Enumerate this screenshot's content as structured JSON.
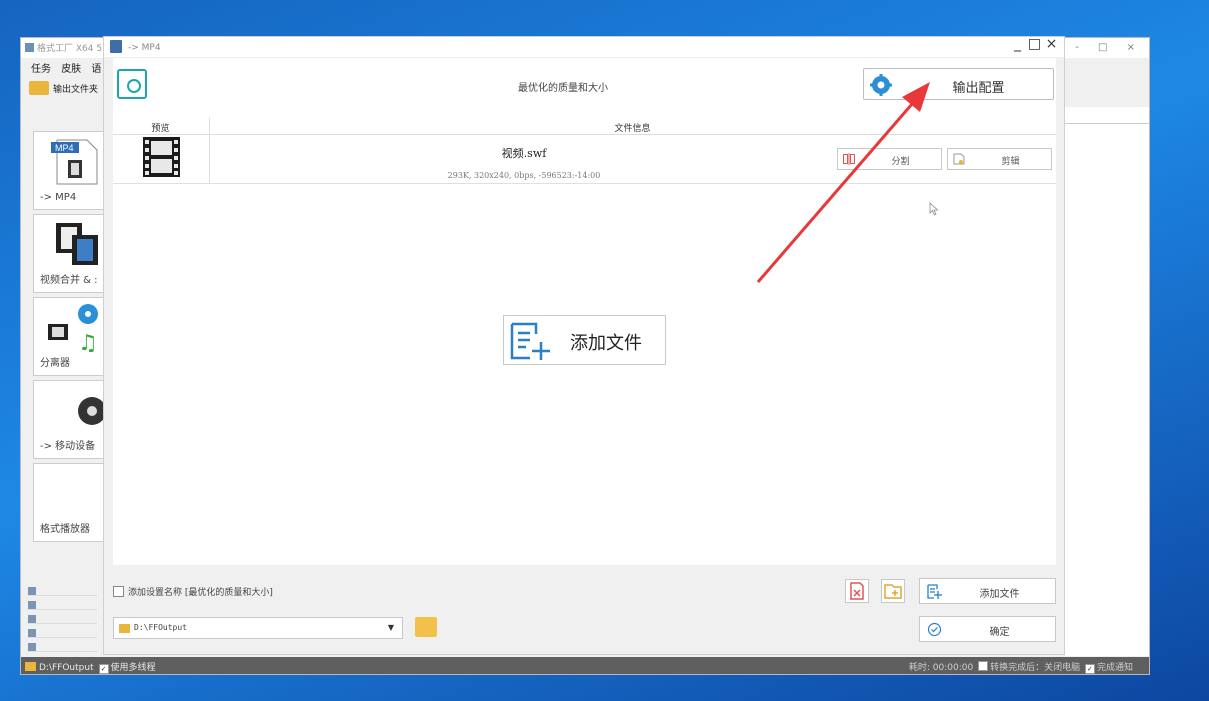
{
  "background_app": {
    "title": "格式工厂 X64 5",
    "menu": [
      "任务",
      "皮肤",
      "语"
    ],
    "output_folder_button": "输出文件夹",
    "categories": [
      {
        "label": "-> MP4",
        "icon": "mp4-file-icon"
      },
      {
        "label": "视频合并 & :",
        "icon": "video-merge-icon"
      },
      {
        "label": "分离器",
        "icon": "splitter-icon"
      },
      {
        "label": "-> 移动设备",
        "icon": "mobile-device-icon"
      },
      {
        "label": "格式播放器",
        "icon": "player-icon"
      }
    ],
    "window_controls": "- □ ×",
    "status": {
      "output_path": "D:\\FFOutput",
      "multithread": "使用多线程",
      "right_text": "耗时: 00:00:00",
      "after_convert": "转换完成后：关闭电脑",
      "notify": "完成通知"
    }
  },
  "dialog": {
    "title": "-> MP4",
    "controls": {
      "minimize": "_",
      "maximize": "□",
      "close": "×"
    },
    "preset_label": "最优化的质量和大小",
    "output_config_button": "输出配置",
    "table": {
      "headers": {
        "preview": "预览",
        "file_info": "文件信息"
      },
      "rows": [
        {
          "name": "视频.swf",
          "meta": "293K, 320x240, 0bps, -596523:-14:00",
          "split_button": "分割",
          "clip_button": "剪辑"
        }
      ]
    },
    "add_file_center": "添加文件",
    "bottom": {
      "add_setting_name": "添加设置名称 [最优化的质量和大小]",
      "add_file_button": "添加文件",
      "ok_button": "确定",
      "output_path": "D:\\FFOutput"
    }
  },
  "colors": {
    "desktop": "#1e88e5",
    "accent_teal": "#19a6ad",
    "folder_yellow": "#e9b53d",
    "annotation_red": "#e8383a",
    "gear_blue": "#2a8fd6"
  }
}
